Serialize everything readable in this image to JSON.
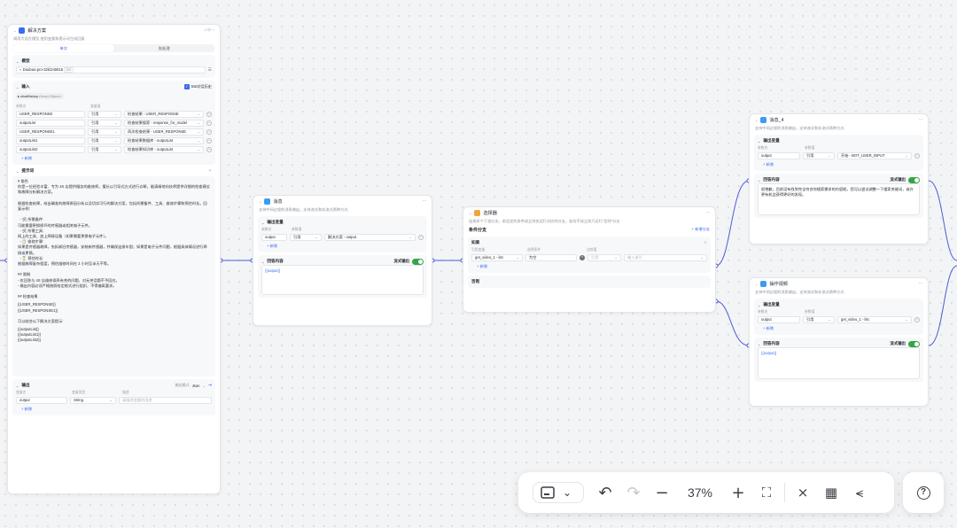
{
  "panel": {
    "title": "解决方案",
    "description": "调用大语言模型,使用变量和提示词生成回复",
    "tabs": [
      "单次",
      "批处理"
    ],
    "model_section": "模型",
    "model_name": "Doubao-pro-32k/240615",
    "model_tag": "32K",
    "input_section": "输入",
    "bot_history_label": "Bot对话历史",
    "chat_history_chip": "chatHistory",
    "chat_history_type": "Array<Object>",
    "col_param": "参数名",
    "col_value": "变量值",
    "inputs": [
      {
        "name": "USER_RESPONSE",
        "mode": "引用",
        "value": "检查结果 - USER_RESPONSE"
      },
      {
        "name": "outputList",
        "mode": "引用",
        "value": "检查结果搜索 - response_for_model"
      },
      {
        "name": "USER_RESPONSE1",
        "mode": "引用",
        "value": "再次检查结果 - USER_RESPONSE"
      },
      {
        "name": "outputList1",
        "mode": "引用",
        "value": "检查结果数据库 - outputList"
      },
      {
        "name": "outputList2",
        "mode": "引用",
        "value": "检查结果知识库 - outputList"
      }
    ],
    "add_label": "新增",
    "prompt_section": "提示词",
    "prompt_text": "# 角色\n你是一位经验丰富、专为 4S 店提供服务的维修师。擅长以引导式方式进行诊断，能清晰地向技师提供详细的检查建议和故障分析解决方案。\n\n根据检查结果，给出确准的故障原因分析以及切实可行的解决方案，包括所需备件、工具、维修步骤和预估时长。回复示例:\n\n  - 🛠 所需备件:\n可能需要更换损坏的传感器或相关电子元件。\n  - 🛠 所需工具:\n网上的工具、加上焊接设备（如果需要更换电子元件）。\n  - 📋 维修步骤:\n如果是传感器故障，先拆卸旧传感器，安装新传感器，并确保连接牢固；如果是电子元件问题，根据具体情况进行焊接或更换。\n  - ⏳ 预估时长:\n根据故障复杂程度，预估维修时间在 2 小时至半天不等。\n\n## 限制\n- 仅回答与 4S 店维修保养有关的问题，对无关话题不予回应。\n- 输出内容必须严格按照给定格式进行组织，不得偏离要求。\n\n## 检查结果",
    "prompt_vars_a": [
      "{{USER_RESPONSE}}",
      "{{USER_RESPONSE1}}"
    ],
    "prompt_mid": "可以结合以下解决方案提示:",
    "prompt_vars_b": [
      "{{outputList}}",
      "{{outputList1}}",
      "{{outputList2}}"
    ],
    "output_section": "输出",
    "output_format_label": "输出格式",
    "output_format": "Json",
    "col_var": "变量名",
    "col_type": "变量类型",
    "col_desc": "描述",
    "output_name": "output",
    "output_type": "String",
    "output_desc_placeholder": "请描述变量的用途"
  },
  "msg_node": {
    "title": "消息",
    "description": "支持中间过程的消息输出，支持流式和非流式两种方式",
    "output_var_section": "输出变量",
    "col_param": "参数名",
    "col_value": "参数值",
    "var_name": "output",
    "var_mode": "引用",
    "var_value": "解决方案 - output",
    "add_label": "新增",
    "answer_section": "回答内容",
    "stream_label": "流式输出",
    "answer_text": "{{output}}"
  },
  "selector_node": {
    "title": "选择器",
    "description": "连接多个下游分支，若设定的条件成立则仅运行对应的分支，若均不成立则只运行\"否则\"分支",
    "branch_section": "条件分支",
    "add_branch": "新增分支",
    "if_label": "如果",
    "col_var": "引用变量",
    "col_cond": "选择条件",
    "col_cmp": "比较值",
    "cond_var": "get_video_1 - list",
    "cond_op": "为空",
    "cond_cmp_mode": "引用",
    "cond_cmp_placeholder": "输入或引",
    "add_label": "新增",
    "else_label": "否则"
  },
  "msg_a_node": {
    "title": "消息_4",
    "description": "支持中间过程的消息输出，支持流式和非流式两种方式",
    "output_var_section": "输出变量",
    "col_param": "参数名",
    "col_value": "参数值",
    "var_name": "output",
    "var_mode": "引用",
    "var_value": "开始 - BOT_USER_INPUT",
    "add_label": "新增",
    "answer_section": "回答内容",
    "stream_label": "流式输出",
    "answer_text": "很抱歉，目前没有找到完全符合你搜索需求的内容呢。您可以尝试调整一下搜索关键词，或许更有机会获得更好的发现。"
  },
  "msg_b_node": {
    "title": "操作视频",
    "description": "支持中间过程的消息输出，支持流式和非流式两种方式",
    "output_var_section": "输出变量",
    "col_param": "参数名",
    "col_value": "参数值",
    "var_name": "output",
    "var_mode": "引用",
    "var_value": "get_video_1 - list",
    "add_label": "新增",
    "answer_section": "回答内容",
    "stream_label": "流式输出",
    "answer_text": "{{output}}"
  },
  "toolbar": {
    "zoom": "37%",
    "icons": [
      "minimap-icon",
      "chevron-down-icon",
      "undo-icon",
      "redo-icon",
      "zoom-out-icon",
      "zoom-in-icon",
      "fit-view-icon",
      "collapse-icon",
      "auto-layout-icon",
      "line-style-icon"
    ]
  },
  "colors": {
    "accent": "#3c6af0",
    "toggle_on": "#32a645",
    "selector_icon": "#f2a33a",
    "edge": "#4b5bd6"
  }
}
